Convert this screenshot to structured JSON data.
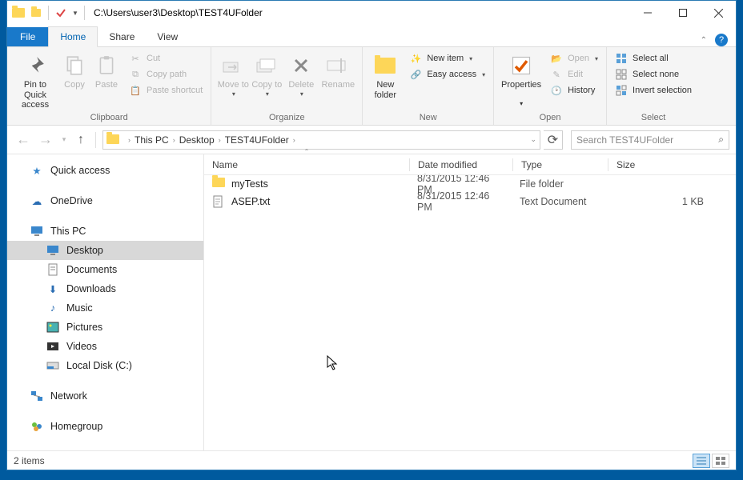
{
  "title_path": "C:\\Users\\user3\\Desktop\\TEST4UFolder",
  "tabs": {
    "file": "File",
    "home": "Home",
    "share": "Share",
    "view": "View"
  },
  "ribbon": {
    "pin": "Pin to Quick access",
    "copy": "Copy",
    "paste": "Paste",
    "cut": "Cut",
    "copypath": "Copy path",
    "pasteshortcut": "Paste shortcut",
    "clipboard": "Clipboard",
    "moveto": "Move to",
    "copyto": "Copy to",
    "delete": "Delete",
    "rename": "Rename",
    "organize": "Organize",
    "newfolder": "New folder",
    "newitem": "New item",
    "easyaccess": "Easy access",
    "new": "New",
    "properties": "Properties",
    "open": "Open",
    "edit": "Edit",
    "history": "History",
    "opengrp": "Open",
    "selectall": "Select all",
    "selectnone": "Select none",
    "invert": "Invert selection",
    "selectgrp": "Select"
  },
  "breadcrumb": [
    "This PC",
    "Desktop",
    "TEST4UFolder"
  ],
  "search_placeholder": "Search TEST4UFolder",
  "nav": {
    "quick": "Quick access",
    "onedrive": "OneDrive",
    "thispc": "This PC",
    "desktop": "Desktop",
    "documents": "Documents",
    "downloads": "Downloads",
    "music": "Music",
    "pictures": "Pictures",
    "videos": "Videos",
    "localdisk": "Local Disk (C:)",
    "network": "Network",
    "homegroup": "Homegroup"
  },
  "columns": {
    "name": "Name",
    "date": "Date modified",
    "type": "Type",
    "size": "Size"
  },
  "rows": [
    {
      "name": "myTests",
      "date": "8/31/2015 12:46 PM",
      "type": "File folder",
      "size": "",
      "kind": "folder"
    },
    {
      "name": "ASEP.txt",
      "date": "8/31/2015 12:46 PM",
      "type": "Text Document",
      "size": "1 KB",
      "kind": "file"
    }
  ],
  "status": "2 items"
}
